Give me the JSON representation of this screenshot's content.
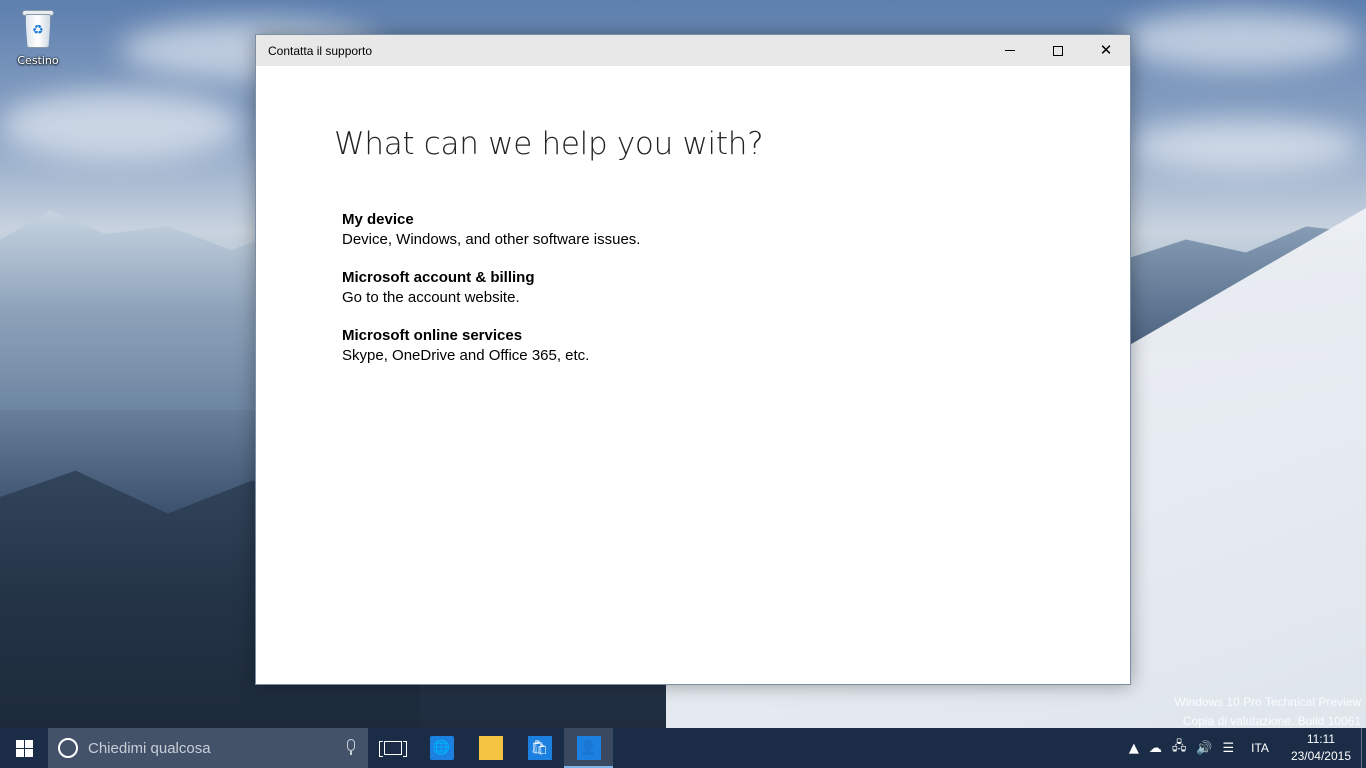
{
  "desktop": {
    "icons": [
      {
        "label": "Cestino",
        "icon": "recycle-bin-icon"
      }
    ],
    "watermark": {
      "line1": "Windows 10 Pro Technical Preview",
      "line2": "Copia di valutazione. Build 10061"
    }
  },
  "window": {
    "title": "Contatta il supporto",
    "heading": "What can we help you with?",
    "options": [
      {
        "title": "My device",
        "description": "Device, Windows, and other software issues."
      },
      {
        "title": "Microsoft account & billing",
        "description": "Go to the account website."
      },
      {
        "title": "Microsoft online services",
        "description": "Skype, OneDrive and Office 365, etc."
      }
    ]
  },
  "taskbar": {
    "search": {
      "placeholder": "Chiedimi qualcosa"
    },
    "apps": [
      {
        "name": "task-view",
        "icon": "task-view-icon"
      },
      {
        "name": "browser",
        "icon": "globe-icon",
        "active": false
      },
      {
        "name": "file-explorer",
        "icon": "folder-icon",
        "active": false
      },
      {
        "name": "store",
        "icon": "store-icon",
        "active": false
      },
      {
        "name": "contact-support",
        "icon": "person-icon",
        "active": true
      }
    ],
    "tray": {
      "language": "ITA",
      "time": "11:11",
      "date": "23/04/2015"
    }
  },
  "colors": {
    "taskbar": "#1a2c46",
    "accent": "#1b80e0",
    "titlebar": "#e8e8e8"
  }
}
